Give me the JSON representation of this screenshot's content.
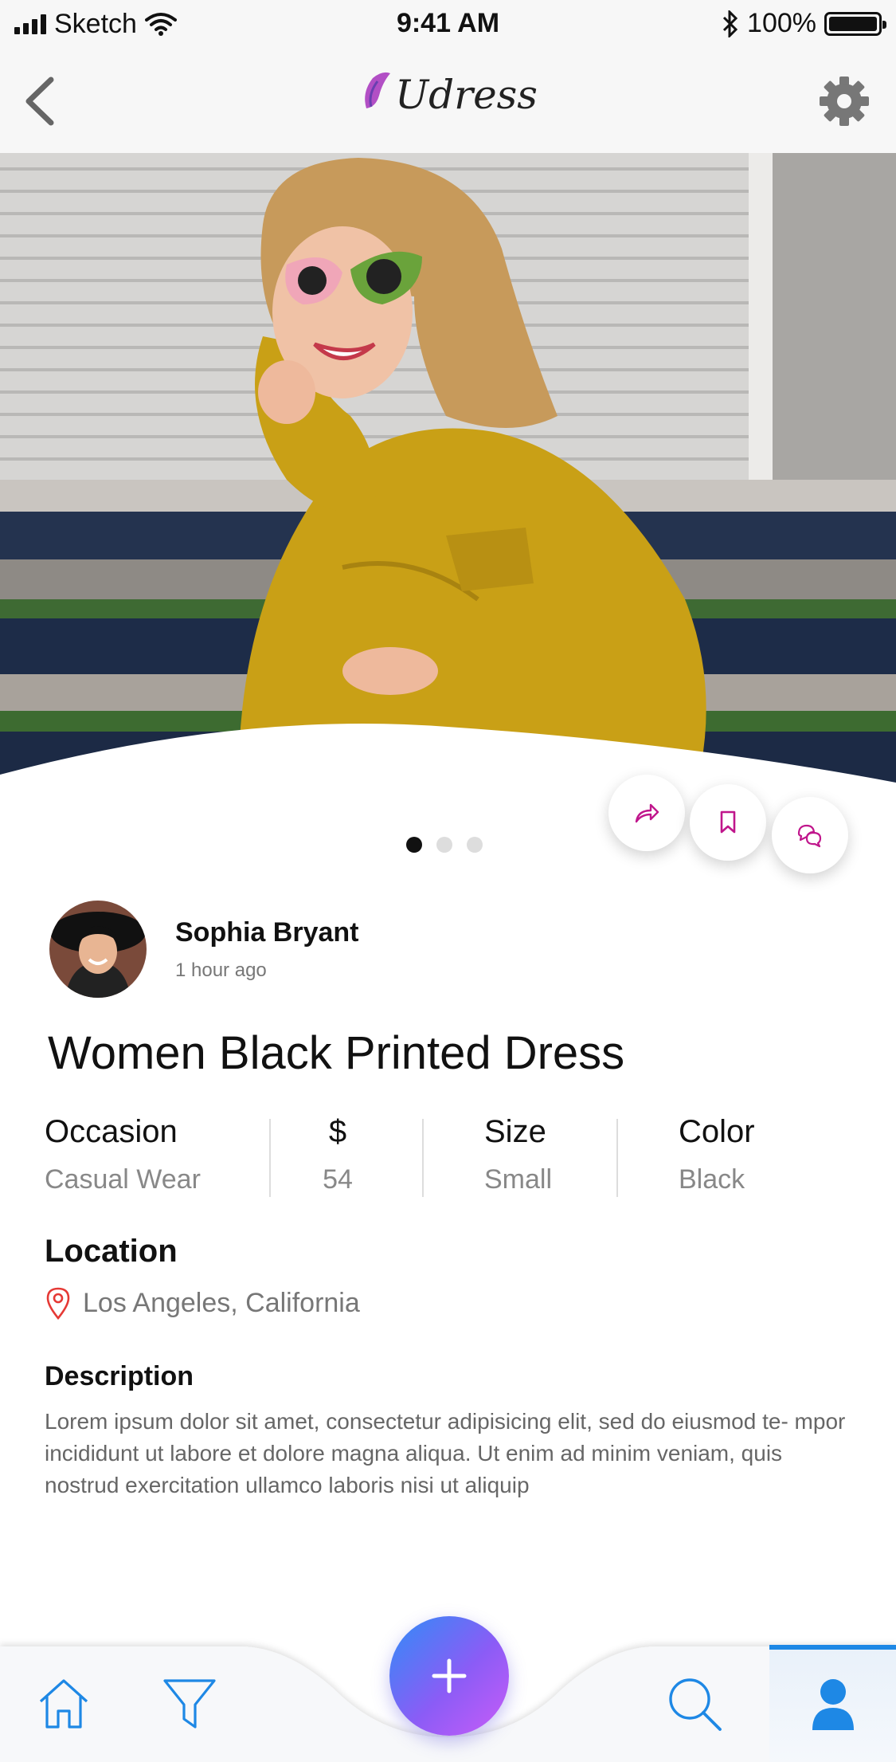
{
  "status_bar": {
    "carrier": "Sketch",
    "time": "9:41 AM",
    "battery": "100%"
  },
  "nav": {
    "logo_text": "Udress"
  },
  "carousel": {
    "active_index": 0,
    "total": 3
  },
  "post": {
    "author_name": "Sophia Bryant",
    "posted_time": "1 hour ago",
    "title": "Women Black Printed Dress",
    "specs": [
      {
        "label": "Occasion",
        "value": "Casual Wear"
      },
      {
        "label": "$",
        "value": "54"
      },
      {
        "label": "Size",
        "value": "Small"
      },
      {
        "label": "Color",
        "value": "Black"
      }
    ],
    "location_heading": "Location",
    "location": "Los Angeles, California",
    "description_heading": "Description",
    "description": "Lorem ipsum dolor sit amet, consectetur adipisicing elit, sed do eiusmod te- mpor incididunt ut labore et dolore magna aliqua. Ut enim ad minim veniam, quis nostrud exercitation ullamco laboris nisi ut aliquip"
  },
  "icons": {
    "back": "chevron-left-icon",
    "settings": "gear-icon",
    "share": "share-icon",
    "bookmark": "bookmark-icon",
    "chat": "chat-icon",
    "location": "location-pin-icon",
    "home": "home-icon",
    "filter": "filter-icon",
    "add": "plus-icon",
    "search": "search-icon",
    "profile": "user-icon"
  },
  "colors": {
    "accent_pink": "#c0168c",
    "tab_blue": "#1e88e5",
    "fab_start": "#2f8df7",
    "fab_end": "#c95cf8",
    "location_red": "#e53935"
  }
}
